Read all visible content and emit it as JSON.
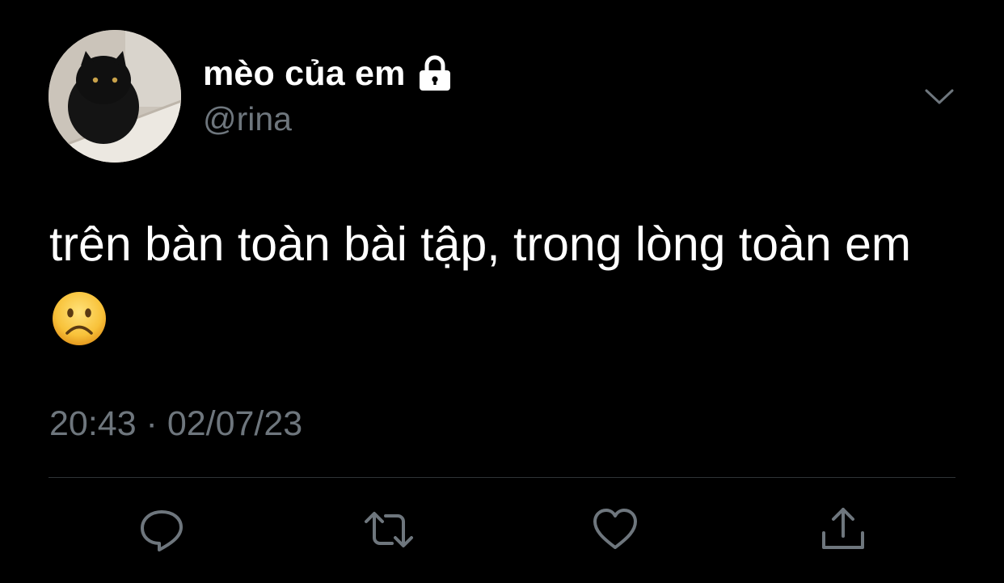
{
  "user": {
    "display_name": "mèo của em",
    "handle": "@rina"
  },
  "icons": {
    "lock": "lock-icon",
    "more": "chevron-down-icon",
    "reply": "reply-icon",
    "retweet": "retweet-icon",
    "like": "heart-icon",
    "share": "share-icon",
    "emoji": "frowning-face-emoji"
  },
  "tweet": {
    "text": "trên bàn toàn bài tập, trong lòng toàn em",
    "timestamp": "20:43 · 02/07/23"
  },
  "colors": {
    "background": "#000000",
    "text_primary": "#ffffff",
    "text_secondary": "#6e767d",
    "divider": "#2f3336"
  }
}
